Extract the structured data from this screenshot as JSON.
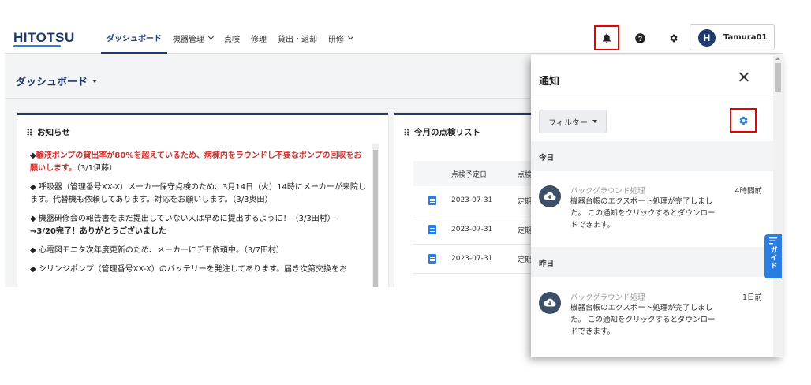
{
  "header": {
    "logo": "HITOTSU",
    "nav": [
      {
        "label": "ダッシュボード",
        "active": true,
        "dropdown": false
      },
      {
        "label": "機器管理",
        "active": false,
        "dropdown": true
      },
      {
        "label": "点検",
        "active": false,
        "dropdown": false
      },
      {
        "label": "修理",
        "active": false,
        "dropdown": false
      },
      {
        "label": "貸出・返却",
        "active": false,
        "dropdown": false
      },
      {
        "label": "研修",
        "active": false,
        "dropdown": true
      }
    ],
    "user": {
      "initial": "H",
      "name": "Tamura01"
    }
  },
  "dashboard": {
    "title": "ダッシュボード",
    "news": {
      "title": "お知らせ",
      "items": [
        {
          "bullet": "◆",
          "highlight": "輸液ポンプの貸出率が80%を超えているため、病棟内をラウンドし不要なポンプの回収をお願いします。",
          "note": "（3/1伊藤）"
        },
        {
          "bullet": "◆",
          "text": "呼吸器（管理番号XX-X）メーカー保守点検のため、3月14日（火）14時にメーカーが来院します。代替機も依頼してあります。対応をお願いします。（3/3奥田）"
        },
        {
          "bullet": "◆",
          "struck": "機器研修会の報告書をまだ提出していない人は早めに提出するように！（3/3田村）",
          "followup": "→3/20完了！ありがとうございました"
        },
        {
          "bullet": "◆",
          "text": "心電図モニタ次年度更新のため、メーカーにデモ依頼中。（3/7田村）"
        },
        {
          "bullet": "◆",
          "text": "シリンジポンプ（管理番号XX-X）のバッテリーを発注してあります。届き次第交換をお"
        }
      ]
    },
    "checklist": {
      "title": "今月の点検リスト",
      "columns": [
        "点検予定日",
        "点検"
      ],
      "rows": [
        {
          "date": "2023-07-31",
          "type": "定期"
        },
        {
          "date": "2023-07-31",
          "type": "定期"
        },
        {
          "date": "2023-07-31",
          "type": "定期"
        }
      ]
    }
  },
  "notifications": {
    "title": "通知",
    "filter_label": "フィルター",
    "sections": [
      {
        "label": "今日",
        "items": [
          {
            "category": "バックグラウンド処理",
            "time": "4時間前",
            "body": "機器台帳のエクスポート処理が完了しました。 この通知をクリックするとダウンロードできます。"
          }
        ]
      },
      {
        "label": "昨日",
        "items": [
          {
            "category": "バックグラウンド処理",
            "time": "1日前",
            "body": "機器台帳のエクスポート処理が完了しました。 この通知をクリックするとダウンロードできます。"
          }
        ]
      }
    ]
  },
  "guide": {
    "label": "ガイド"
  },
  "colors": {
    "brand": "#1e3a6e",
    "accent": "#2a7de1",
    "highlight_border": "#ee0000",
    "alert_text": "#d0312d"
  }
}
